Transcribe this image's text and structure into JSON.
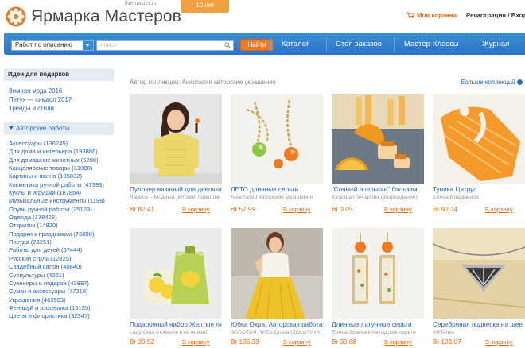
{
  "header": {
    "brand": "Ярмарка Мастеров",
    "domain": "livemaster.ru",
    "ribbon": "10 лет",
    "cart": "Моя корзина",
    "auth": "Регистрация / Вход"
  },
  "navbar": {
    "select_value": "Работ по описанию",
    "search_placeholder": "поиск",
    "find_button": "Найти",
    "links": [
      "Каталог",
      "Стоп заказов",
      "Мастер-Классы",
      "Журнал"
    ]
  },
  "sidebar": {
    "gift_header": "Идеи для подарков",
    "gift_links": [
      "Зимняя мода 2016",
      "Петух — символ 2017",
      "Тренды и стили"
    ],
    "works_header": "Авторские работы",
    "categories": [
      "Аксессуары (136245)",
      "Для дома и интерьера (193886)",
      "Для домашних животных (5208)",
      "Канцелярские товары (31080)",
      "Картины и панно (105832)",
      "Косметика ручной работы (47393)",
      "Куклы и игрушки (187864)",
      "Музыкальные инструменты (1198)",
      "Обувь ручной работы (25163)",
      "Одежда (178423)",
      "Открытки (14820)",
      "Подарки к праздникам (73800)",
      "Посуда (23251)",
      "Работы для детей (67444)",
      "Русский стиль (12825)",
      "Свадебный салон (40840)",
      "Субкультуры (4021)",
      "Сувениры и подарки (43887)",
      "Сумки и аксессуары (77218)",
      "Украшения (463593)",
      "Фен-шуй и эзотерика (16135)",
      "Цветы и флористика (32347)"
    ]
  },
  "main": {
    "collection_author": "Автор коллекции: Анастасия авторские украшения",
    "more_collections": "Больше коллекций",
    "buy_label": "В корзину",
    "products": [
      {
        "title": "Пуловер вязаный для девочки",
        "author": "Лариса – Модный детский трикотаж",
        "price": "Br 82.41"
      },
      {
        "title": "ЛЕТО длинные серьги",
        "author": "Анастасия авторские украшения",
        "price": "Br 57.99"
      },
      {
        "title": "\"Сочный апельсин\" бальзам",
        "author": "Катюша Гончарова (возрождение)",
        "price": "Br 3.05"
      },
      {
        "title": "Туника Цитрус",
        "author": "Елена Владимира",
        "price": "Br 90.34"
      },
      {
        "title": "Подарочный набор Желтые лимоны",
        "author": "Lady Olga (лочерок в интерьер)",
        "price": "Br 30.52"
      },
      {
        "title": "Юбка Охра, Авторская работа",
        "author": "ЗОЛОТАЯ НИТЬ Ольга (ZOLOTAYA)",
        "price": "Br 195.33"
      },
      {
        "title": "Длинные латунные серьги",
        "author": "Елена Strangell Авторские серьги",
        "price": "Br 39.68"
      },
      {
        "title": "Серебряная подвеска на шее",
        "author": "ARTemis",
        "price": "Br 103.07"
      }
    ]
  },
  "colors": {
    "accent": "#f07a22",
    "nav_blue": "#2a74c4",
    "link": "#2a64b0"
  }
}
